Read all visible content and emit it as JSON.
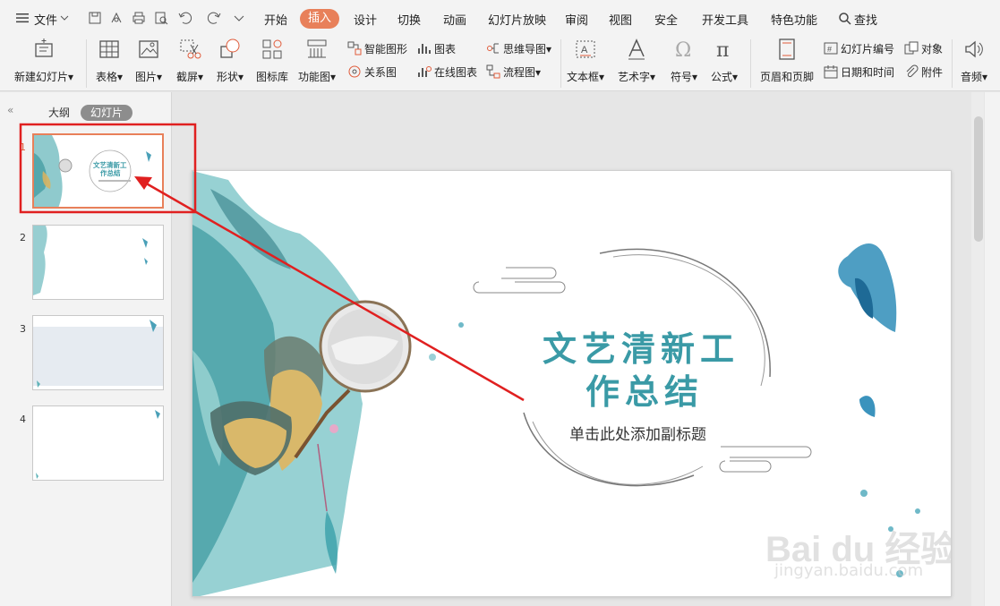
{
  "menubar": {
    "file": "文件",
    "tabs": [
      "开始",
      "插入",
      "设计",
      "切换",
      "动画",
      "幻灯片放映",
      "审阅",
      "视图",
      "安全",
      "开发工具",
      "特色功能"
    ],
    "active_tab": "插入",
    "search": "查找"
  },
  "ribbon": {
    "new_slide": "新建幻灯片",
    "table": "表格",
    "picture": "图片",
    "screenshot": "截屏",
    "shape": "形状",
    "icon_lib": "图标库",
    "func_chart": "功能图",
    "smart_art": "智能图形",
    "chart": "图表",
    "relation": "关系图",
    "online_chart": "在线图表",
    "mind_map": "思维导图",
    "flowchart": "流程图",
    "textbox": "文本框",
    "word_art": "艺术字",
    "symbol": "符号",
    "formula": "公式",
    "header_footer": "页眉和页脚",
    "slide_number": "幻灯片编号",
    "object": "对象",
    "date_time": "日期和时间",
    "attachment": "附件",
    "audio": "音频"
  },
  "leftpanel": {
    "outline_tab": "大纲",
    "slides_tab": "幻灯片",
    "slide_numbers": [
      "1",
      "2",
      "3",
      "4"
    ],
    "thumb1_title": "文艺清新工作总结",
    "thumb1_title_a": "文艺清新工",
    "thumb1_title_b": "作总结"
  },
  "slide": {
    "title_line1": "文艺清新工",
    "title_line2": "作总结",
    "subtitle": "单击此处添加副标题",
    "watermark_main": "Bai du 经验",
    "watermark_url": "jingyan.baidu.com"
  },
  "colors": {
    "accent": "#e8805a",
    "title_teal": "#3a9aa6",
    "annotation_red": "#e02020"
  }
}
